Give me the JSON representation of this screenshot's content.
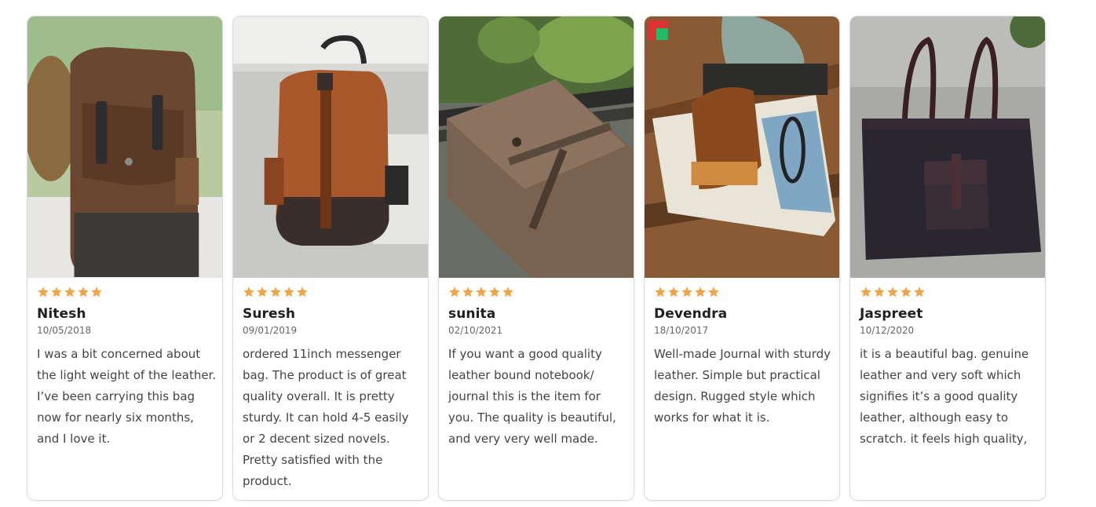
{
  "accent": {
    "star": "#f0a54a"
  },
  "reviews": [
    {
      "rating": 5,
      "name": "Nitesh",
      "date": "10/05/2018",
      "text": "I was a bit concerned about the light weight of the leather. I’ve been carrying this bag now for nearly six months, and I love it.",
      "photo_subject": "brown leather backpack"
    },
    {
      "rating": 5,
      "name": "Suresh",
      "date": "09/01/2019",
      "text": "ordered 11inch messenger bag. The product is of great quality overall. It is pretty sturdy. It can hold 4-5 easily or 2 decent sized novels. Pretty satisfied with the product.",
      "photo_subject": "tan leather backpack"
    },
    {
      "rating": 5,
      "name": "sunita",
      "date": "02/10/2021",
      "text": "If you want a good quality leather bound notebook/ journal this is the item for you. The quality is beautiful, and very very well made.",
      "photo_subject": "leather bound journal"
    },
    {
      "rating": 5,
      "name": "Devendra",
      "date": "18/10/2017",
      "text": "Well-made Journal with sturdy leather. Simple but practical design. Rugged style which works for what it is.",
      "photo_subject": "leather journal on table"
    },
    {
      "rating": 5,
      "name": "Jaspreet",
      "date": "10/12/2020",
      "text": "it is a beautiful bag. genuine leather and very soft which signifies it’s a good quality leather, although easy to scratch. it feels high quality,",
      "photo_subject": "dark leather tote bag"
    }
  ]
}
